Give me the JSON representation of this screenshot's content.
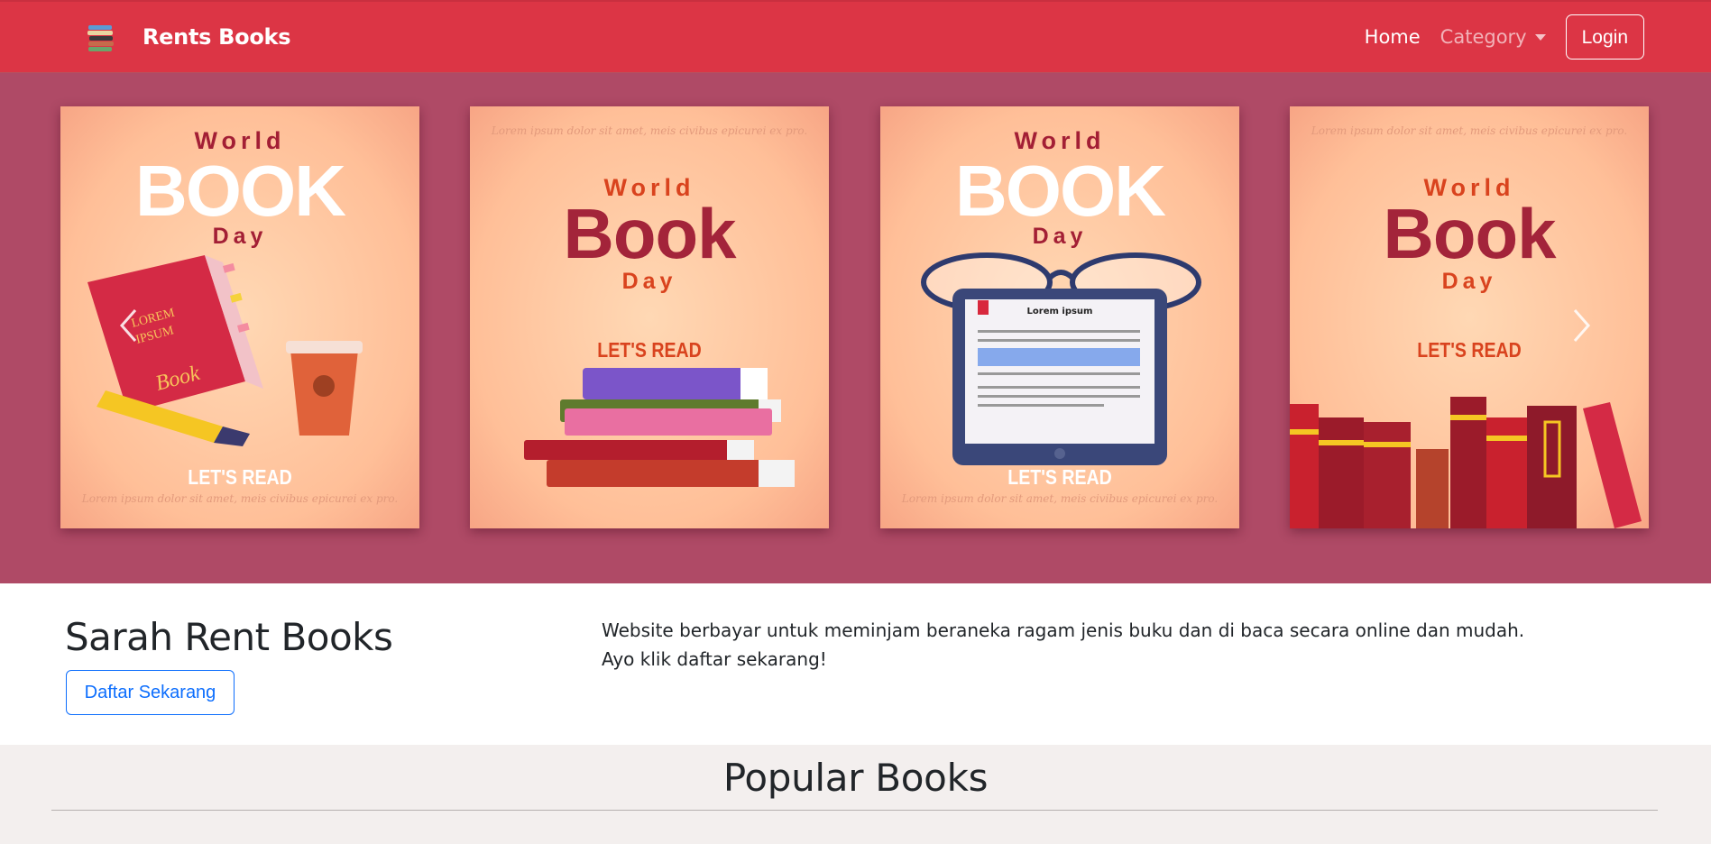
{
  "navbar": {
    "brand": "Rents Books",
    "brand_icon": "book-stack-icon",
    "links": {
      "home": "Home",
      "category": "Category"
    },
    "login": "Login",
    "bg_color": "#dc3545"
  },
  "carousel": {
    "bg_color": "#af4a66",
    "posters": [
      {
        "world": "World",
        "big": "BOOK",
        "day": "Day",
        "read": "LET'S READ",
        "lorem": "Lorem ipsum dolor sit amet, meis civibus epicurei ex pro."
      },
      {
        "lorem": "Lorem ipsum dolor sit amet, meis civibus epicurei ex pro.",
        "world": "World",
        "big": "Book",
        "day": "Day",
        "read": "LET'S READ"
      },
      {
        "world": "World",
        "big": "BOOK",
        "day": "Day",
        "read": "LET'S READ",
        "lorem": "Lorem ipsum dolor sit amet, meis civibus epicurei ex pro.",
        "ereader_title": "Lorem ipsum"
      },
      {
        "lorem": "Lorem ipsum dolor sit amet, meis civibus epicurei ex pro.",
        "world": "World",
        "big": "Book",
        "day": "Day",
        "read": "LET'S READ"
      }
    ]
  },
  "intro": {
    "title": "Sarah Rent Books",
    "button": "Daftar Sekarang",
    "desc_line1": "Website berbayar untuk meminjam beraneka ragam jenis buku dan di baca secara online dan mudah.",
    "desc_line2": "Ayo klik daftar sekarang!"
  },
  "popular": {
    "title": "Popular Books"
  }
}
